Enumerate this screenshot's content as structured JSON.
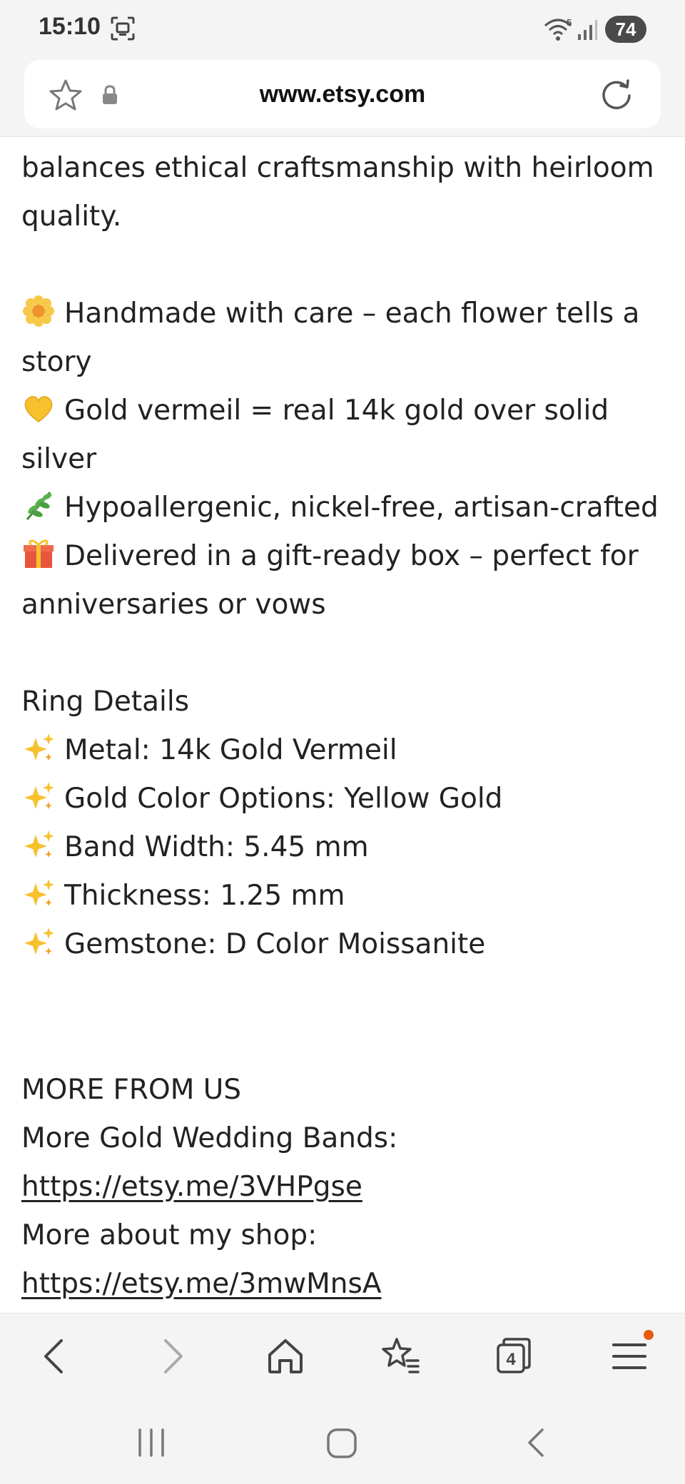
{
  "status_bar": {
    "time": "15:10",
    "battery": "74",
    "wifi_label": "5"
  },
  "browser": {
    "url": "www.etsy.com",
    "tabs_count": "4"
  },
  "description": {
    "intro_line1": "balances ethical craftsmanship with heirloom",
    "intro_line2": "quality.",
    "features": [
      {
        "icon": "blossom-emoji",
        "text_line1": "Handmade with care – each flower tells a",
        "text_line2": "story"
      },
      {
        "icon": "yellow-heart-emoji",
        "text_line1": "Gold vermeil = real 14k gold over solid",
        "text_line2": "silver"
      },
      {
        "icon": "herb-emoji",
        "text_line1": "Hypoallergenic, nickel-free, artisan-crafted",
        "text_line2": ""
      },
      {
        "icon": "gift-emoji",
        "text_line1": "Delivered in a gift-ready box – perfect for",
        "text_line2": "anniversaries or vows"
      }
    ],
    "details_heading": "Ring Details",
    "details": [
      "Metal: 14k Gold Vermeil",
      "Gold Color Options: Yellow Gold",
      "Band Width: 5.45 mm",
      "Thickness: 1.25 mm",
      "Gemstone: D Color Moissanite"
    ],
    "more_heading": "MORE FROM US",
    "more_bands_label": "More Gold Wedding Bands:",
    "more_bands_link": "https://etsy.me/3VHPgse",
    "more_shop_label": "More about my shop:",
    "more_shop_link": "https://etsy.me/3mwMnsA"
  },
  "colors": {
    "accent_dot": "#e8590c",
    "text": "#222222"
  }
}
